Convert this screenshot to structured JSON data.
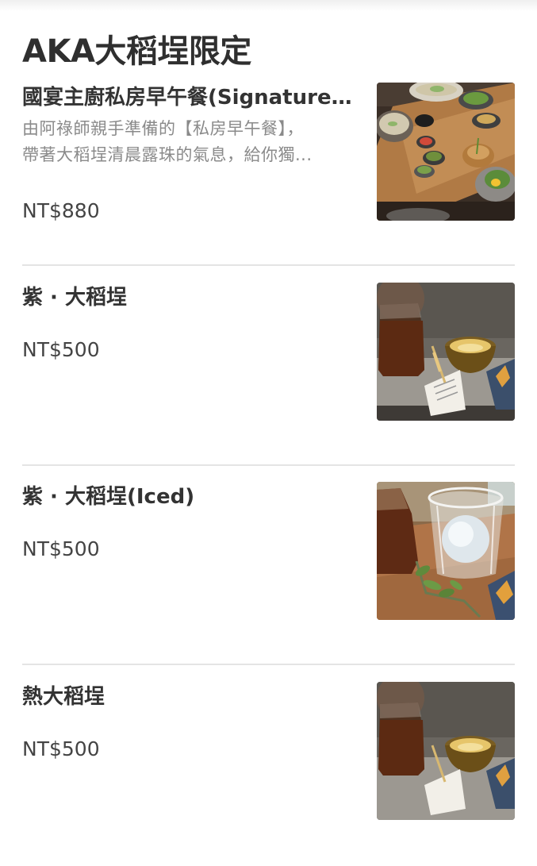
{
  "section": {
    "title": "AKA大稻埕限定"
  },
  "items": [
    {
      "name": "國宴主廚私房早午餐(Signature...)",
      "description_line1": "由阿祿師親手準備的【私房早午餐】，",
      "description_line2": "帶著大稻埕清晨露珠的氣息，給你獨...",
      "price": "NT$880",
      "image_subject": "brunch-set-photo"
    },
    {
      "name": "紫 · 大稻埕",
      "price": "NT$500",
      "image_subject": "tea-pitcher-and-cup-photo"
    },
    {
      "name": "紫 · 大稻埕(Iced)",
      "price": "NT$500",
      "image_subject": "iced-tea-glass-photo"
    },
    {
      "name": "熱大稻埕",
      "price": "NT$500",
      "image_subject": "tea-pitcher-and-cup-photo"
    }
  ],
  "colors": {
    "text_primary": "#333333",
    "text_secondary": "#8a8a8a",
    "divider": "#e4e4e4",
    "background": "#ffffff"
  }
}
